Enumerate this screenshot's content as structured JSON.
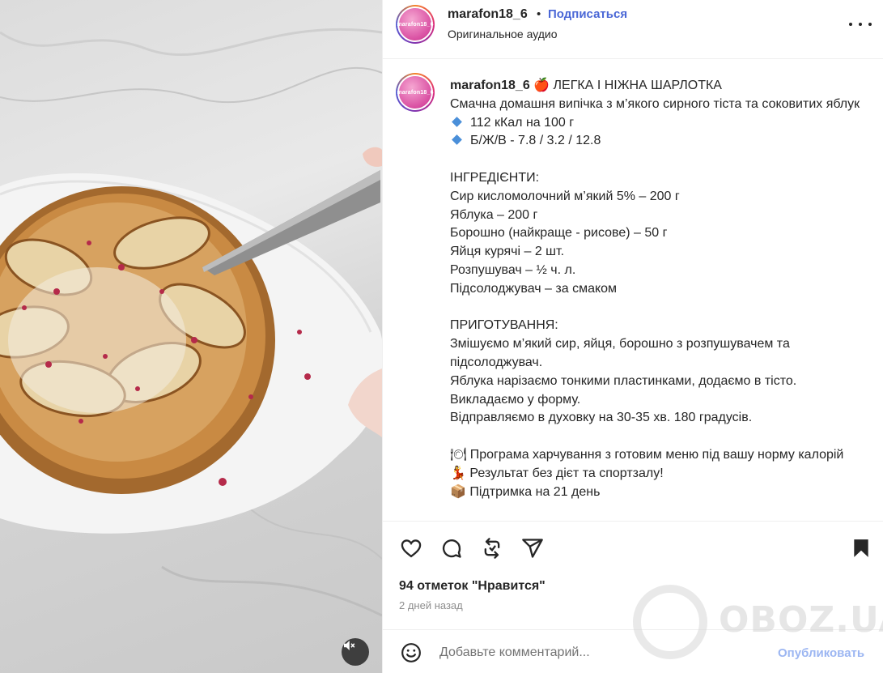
{
  "post": {
    "username": "marafon18_6",
    "separator": "•",
    "follow_label": "Подписаться",
    "audio": "Оригинальное аудио",
    "avatar_text": "marafon18_6"
  },
  "caption": {
    "username": "marafon18_6",
    "title": "🍎 ЛЕГКА І НІЖНА ШАРЛОТКА",
    "intro": "Смачна домашня випічка з м’якого сирного тіста та соковитих яблук",
    "bullets": [
      "112 кКал на 100 г",
      "Б/Ж/В - 7.8 / 3.2 / 12.8"
    ],
    "ingredients_title": "ІНГРЕДІЄНТИ:",
    "ingredients": [
      "Сир кисломолочний м’який 5% – 200 г",
      "Яблука – 200 г",
      "Борошно (найкраще - рисове) – 50 г",
      "Яйця курячі – 2 шт.",
      "Розпушувач – ½ ч. л.",
      "Підсолоджувач – за смаком"
    ],
    "steps_title": "ПРИГОТУВАННЯ:",
    "steps": [
      "Змішуємо м’який сир, яйця, борошно з розпушувачем та підсолоджувач.",
      "Яблука нарізаємо тонкими пластинками, додаємо в тісто.",
      "Викладаємо у форму.",
      "Відправляємо в духовку на 30-35 хв. 180 градусів."
    ],
    "promo_1": "🍽 Програма харчування з готовим меню під вашу норму калорій",
    "promo_2": "💃 Результат без дієт та спортзалу!",
    "promo_3": "📦 Підтримка на 21 день"
  },
  "actions": {
    "icons": [
      "heart-icon",
      "comment-icon",
      "repost-icon",
      "share-icon",
      "bookmark-icon"
    ],
    "likes": "94 отметок \"Нравится\"",
    "time": "2 дней назад",
    "comment_placeholder": "Добавьте комментарий...",
    "publish_label": "Опубликовать"
  },
  "watermark": {
    "text": "OBOZ.UA"
  },
  "colors": {
    "link_blue": "#4a67d6",
    "publish_blue": "#9cb6f2",
    "text": "#262626",
    "muted": "#8e8e8e"
  }
}
